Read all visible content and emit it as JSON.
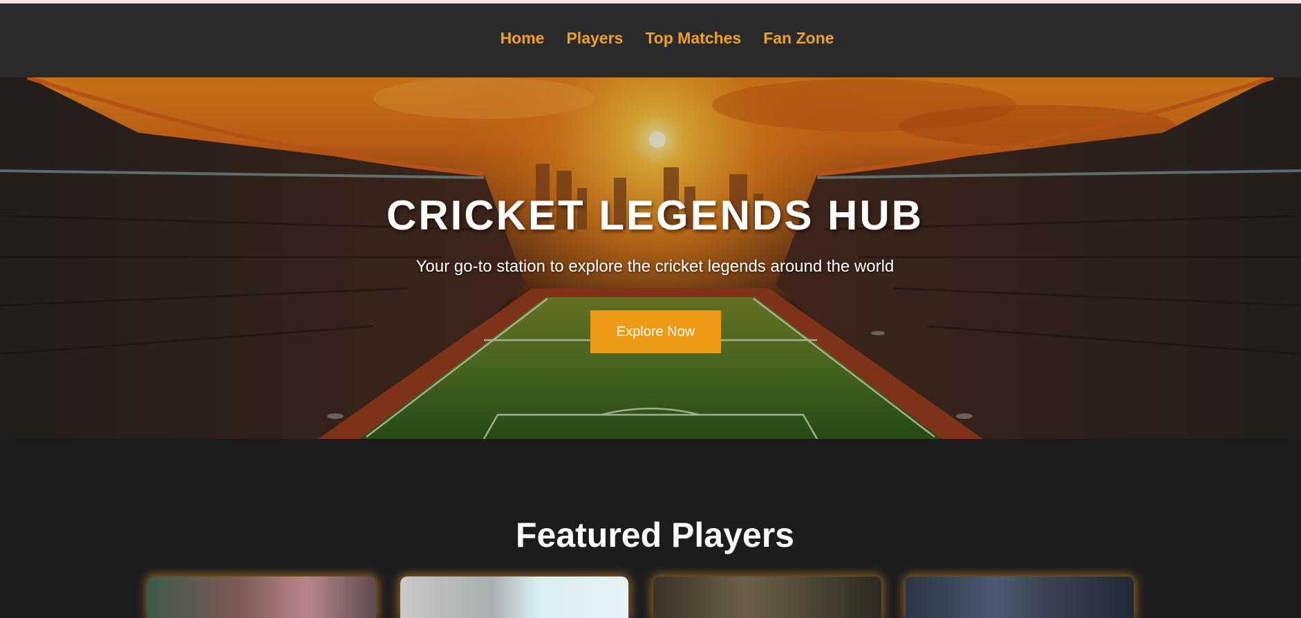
{
  "nav": {
    "items": [
      {
        "label": "Home"
      },
      {
        "label": "Players"
      },
      {
        "label": "Top Matches"
      },
      {
        "label": "Fan Zone"
      }
    ]
  },
  "hero": {
    "title": "CRICKET LEGENDS HUB",
    "subtitle": "Your go-to station to explore the cricket legends around the world",
    "cta_label": "Explore Now",
    "background": "stadium-sunset-image"
  },
  "featured": {
    "title": "Featured Players",
    "cards": [
      {
        "image": "player-photo-1"
      },
      {
        "image": "player-photo-2"
      },
      {
        "image": "player-photo-3"
      },
      {
        "image": "player-photo-4"
      }
    ]
  },
  "colors": {
    "accent": "#f0a11c",
    "button": "#ef9a14",
    "nav_background": "#2a2a2c",
    "page_background": "#1c1c1e"
  }
}
